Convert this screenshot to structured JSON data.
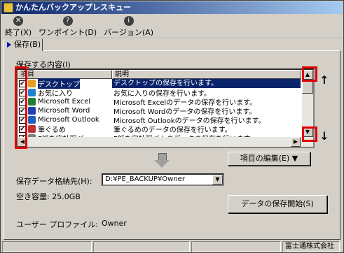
{
  "window": {
    "title": "かんたんバックアップレスキュー"
  },
  "toolbar": [
    {
      "label": "終了(X)",
      "icon": "close-icon"
    },
    {
      "label": "ワンポイント(D)",
      "icon": "help-icon"
    },
    {
      "label": "バージョン(A)",
      "icon": "info-icon"
    }
  ],
  "tab": {
    "label": "保存(B)"
  },
  "group": {
    "label": "保存する内容(I)"
  },
  "list": {
    "columns": [
      "項目",
      "説明"
    ],
    "rows": [
      {
        "item": "デスクトップ",
        "desc": "デスクトップの保存を行います。",
        "checked": true,
        "selected": true,
        "icon_color": "#e0a020"
      },
      {
        "item": "お気に入り",
        "desc": "お気に入りの保存を行います。",
        "checked": true,
        "selected": false,
        "icon_color": "#2080d0"
      },
      {
        "item": "Microsoft Excel",
        "desc": "Microsoft Excelのデータの保存を行います。",
        "checked": true,
        "selected": false,
        "icon_color": "#208030"
      },
      {
        "item": "Microsoft Word",
        "desc": "Microsoft Wordのデータの保存を行います。",
        "checked": true,
        "selected": false,
        "icon_color": "#2040b0"
      },
      {
        "item": "Microsoft Outlook",
        "desc": "Microsoft Outlookのデータの保存を行います。",
        "checked": true,
        "selected": false,
        "icon_color": "#2060c0"
      },
      {
        "item": "筆ぐるめ",
        "desc": "筆ぐるめのデータの保存を行います。",
        "checked": true,
        "selected": false,
        "icon_color": "#c03030"
      },
      {
        "item": "F紙を宮社写バ",
        "desc": "F紙を宮社写バムのデータの保存を行います。",
        "checked": true,
        "selected": false,
        "icon_color": "#808080"
      }
    ]
  },
  "buttons": {
    "edit_items": "項目の編集(E) ▼",
    "start_save": "データの保存開始(S)"
  },
  "destination": {
    "label": "保存データ格納先(H):",
    "value": "D:¥PE_BACKUP¥Owner"
  },
  "free_space": {
    "label": "空き容量: 25.0GB"
  },
  "profile": {
    "label": "ユーザー プロファイル:",
    "value": "Owner"
  },
  "status": {
    "company": "富士通株式会社"
  },
  "colors": {
    "highlight": "#0a246a",
    "annotation": "#e00000"
  }
}
